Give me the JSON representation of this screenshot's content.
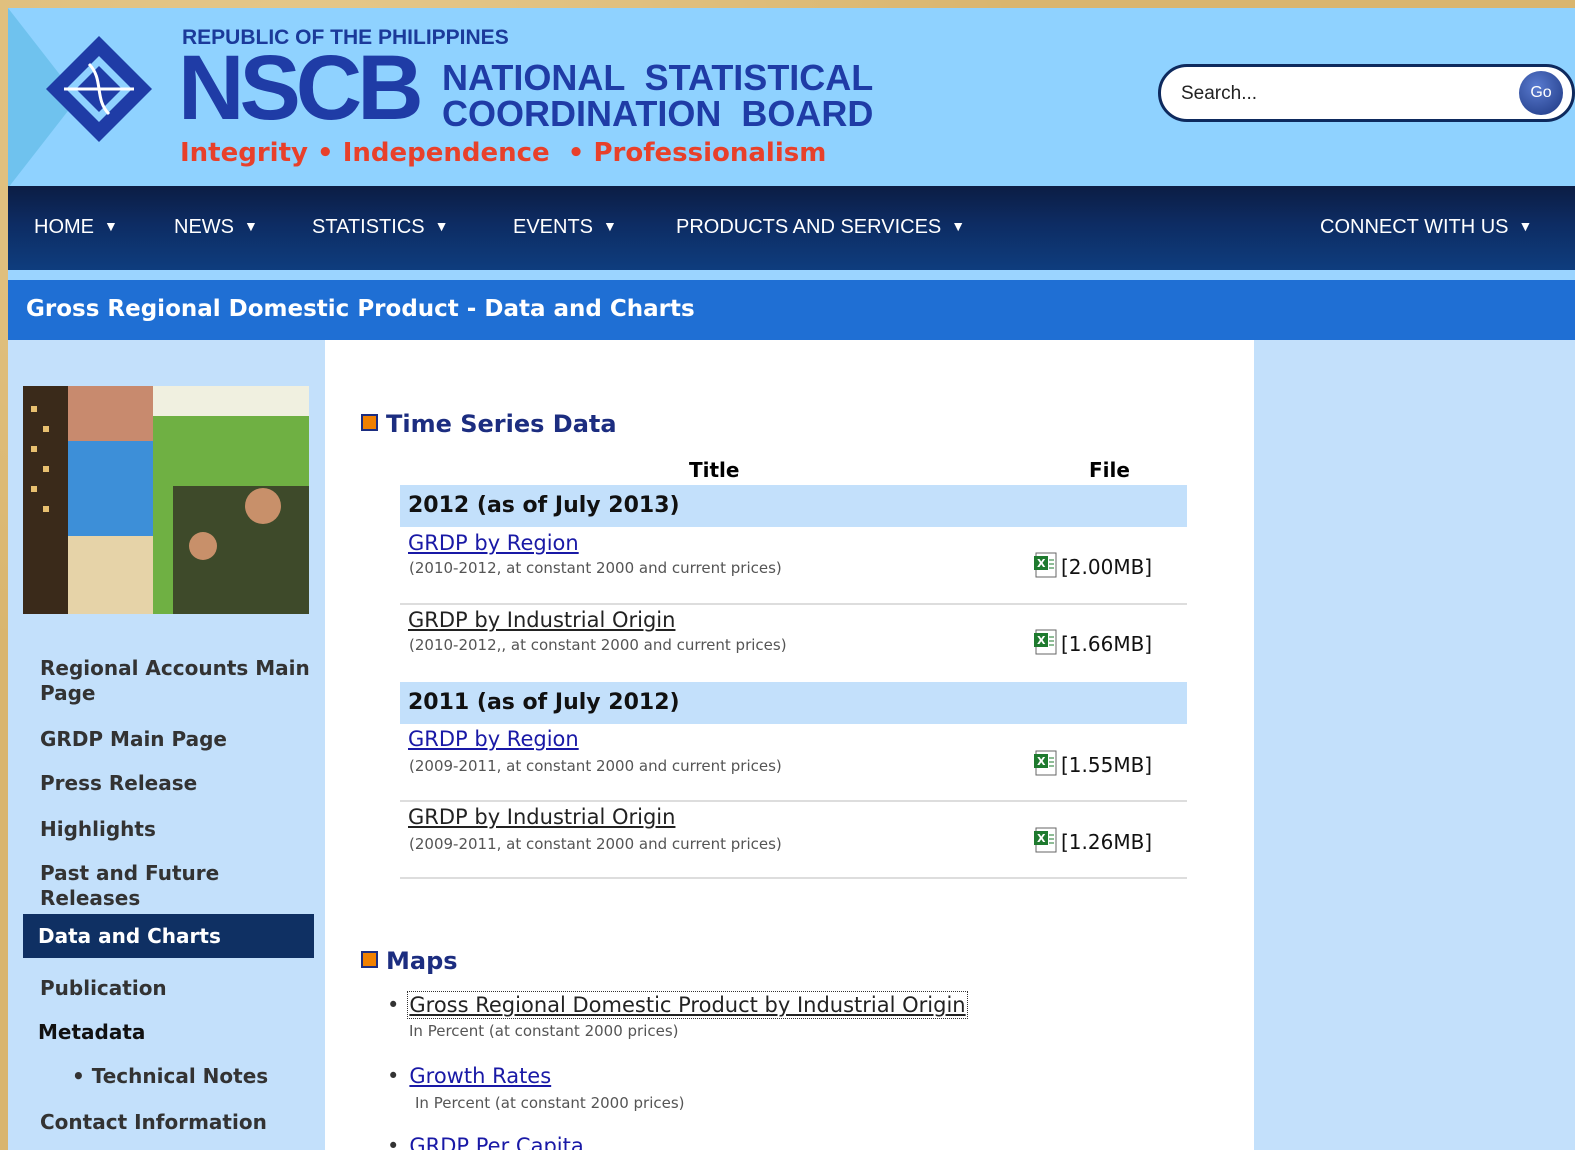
{
  "header": {
    "republic": "REPUBLIC OF THE PHILIPPINES",
    "acronym": "NSCB",
    "org_line1": "NATIONAL  STATISTICAL",
    "org_line2": "COORDINATION  BOARD",
    "tagline": "Integrity • Independence  • Professionalism",
    "search_placeholder": "Search...",
    "go_label": "Go"
  },
  "nav": {
    "items": [
      "HOME",
      "NEWS",
      "STATISTICS",
      "EVENTS",
      "PRODUCTS AND SERVICES",
      "CONNECT WITH US"
    ]
  },
  "page_title": "Gross Regional Domestic Product - Data and Charts",
  "sidebar": {
    "items": [
      "Regional Accounts Main Page",
      "GRDP Main Page",
      "Press Release",
      "Highlights",
      "Past and Future Releases",
      "Data and Charts",
      "Publication",
      "Metadata",
      "• Technical Notes",
      "Contact Information"
    ]
  },
  "time_series": {
    "heading": "Time Series Data",
    "col_title": "Title",
    "col_file": "File",
    "groups": [
      {
        "year": "2012 (as of July 2013)",
        "rows": [
          {
            "title": "GRDP by Region",
            "sub": "(2010-2012, at constant 2000 and current prices)",
            "size": "[2.00MB]"
          },
          {
            "title": "GRDP by Industrial Origin",
            "sub": "(2010-2012,, at constant 2000 and current prices)",
            "size": "[1.66MB]"
          }
        ]
      },
      {
        "year": "2011 (as of July 2012)",
        "rows": [
          {
            "title": "GRDP by Region",
            "sub": "(2009-2011, at constant 2000 and current prices)",
            "size": "[1.55MB]"
          },
          {
            "title": "GRDP by Industrial Origin",
            "sub": "(2009-2011, at constant 2000 and current prices)",
            "size": "[1.26MB]"
          }
        ]
      }
    ]
  },
  "maps": {
    "heading": "Maps",
    "items": [
      {
        "title": "Gross Regional Domestic Product by Industrial Origin",
        "sub": "In Percent (at constant 2000 prices)"
      },
      {
        "title": "Growth Rates",
        "sub": "In Percent (at constant 2000 prices)"
      },
      {
        "title": "GRDP Per Capita",
        "sub": ""
      }
    ]
  },
  "colors": {
    "header_bg": "#8fd2ff",
    "nav_bg": "#0d2c63",
    "title_bar": "#1f6fd4",
    "sidebar_bg": "#c3e0fb",
    "link": "#1919a6",
    "tagline": "#e8402a",
    "active_item": "#0f3063"
  },
  "icons": [
    "nscb-logo-icon",
    "excel-file-icon",
    "caret-down-icon"
  ]
}
